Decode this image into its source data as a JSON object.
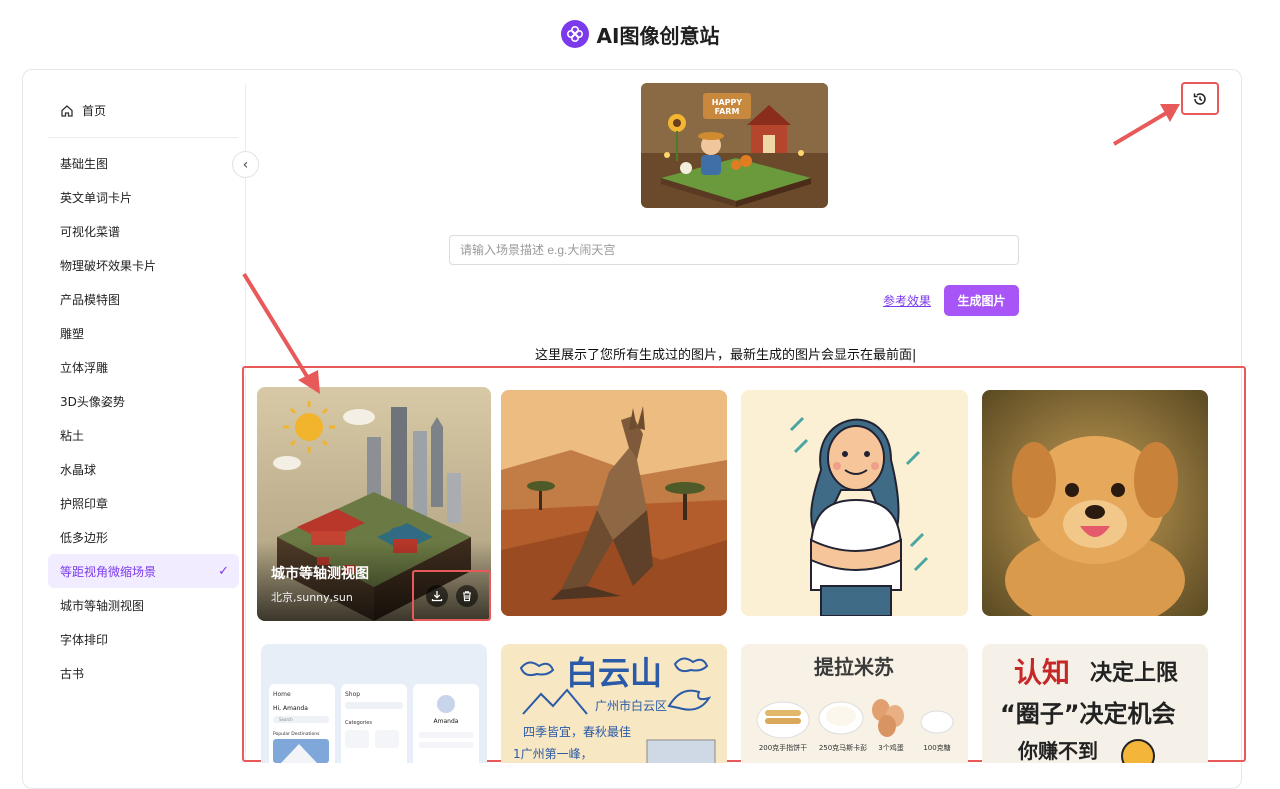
{
  "app": {
    "title": "AI图像创意站",
    "logo_icon": "flower-logo-icon"
  },
  "sidebar": {
    "home_label": "首页",
    "items": [
      {
        "label": "基础生图"
      },
      {
        "label": "英文单词卡片"
      },
      {
        "label": "可视化菜谱"
      },
      {
        "label": "物理破坏效果卡片"
      },
      {
        "label": "产品模特图"
      },
      {
        "label": "雕塑"
      },
      {
        "label": "立体浮雕"
      },
      {
        "label": "3D头像姿势"
      },
      {
        "label": "粘土"
      },
      {
        "label": "水晶球"
      },
      {
        "label": "护照印章"
      },
      {
        "label": "低多边形"
      },
      {
        "label": "等距视角微缩场景",
        "active": true
      },
      {
        "label": "城市等轴测视图"
      },
      {
        "label": "字体排印"
      },
      {
        "label": "古书"
      }
    ]
  },
  "main": {
    "hero_image": {
      "text": "HAPPY FARM"
    },
    "prompt_placeholder": "请输入场景描述 e.g.大闹天宫",
    "reference_link": "参考效果",
    "generate_button": "生成图片",
    "info_text": "这里展示了您所有生成过的图片，最新生成的图片会显示在最前面|"
  },
  "gallery": {
    "first_card": {
      "title": "城市等轴测视图",
      "subtitle": "北京,sunny,sun"
    },
    "row2": {
      "app_mockup": {
        "col1_header": "Home",
        "greeting": "Hi, Amanda",
        "col2_header": "Shop",
        "col3_name": "Amanda",
        "section": "Popular Destinations",
        "categories": "Categories",
        "search": "Search"
      },
      "poster_baiyun": {
        "title": "白云山",
        "location": "广州市白云区",
        "line1": "四季皆宜，春秋最佳",
        "line2": "1广州第一峰，"
      },
      "tiramisu": {
        "title": "提拉米苏",
        "labels": [
          "200克手指饼干",
          "250克马斯卡彭",
          "3个鸡蛋",
          "100克糖"
        ]
      },
      "text_card": {
        "line1a": "认知",
        "line1b": "决定上限",
        "line2": "“圈子”决定机会",
        "line3": "你赚不到"
      }
    }
  },
  "colors": {
    "accent": "#7c3aed",
    "button": "#a855f7",
    "annotation": "#e85a5a"
  }
}
